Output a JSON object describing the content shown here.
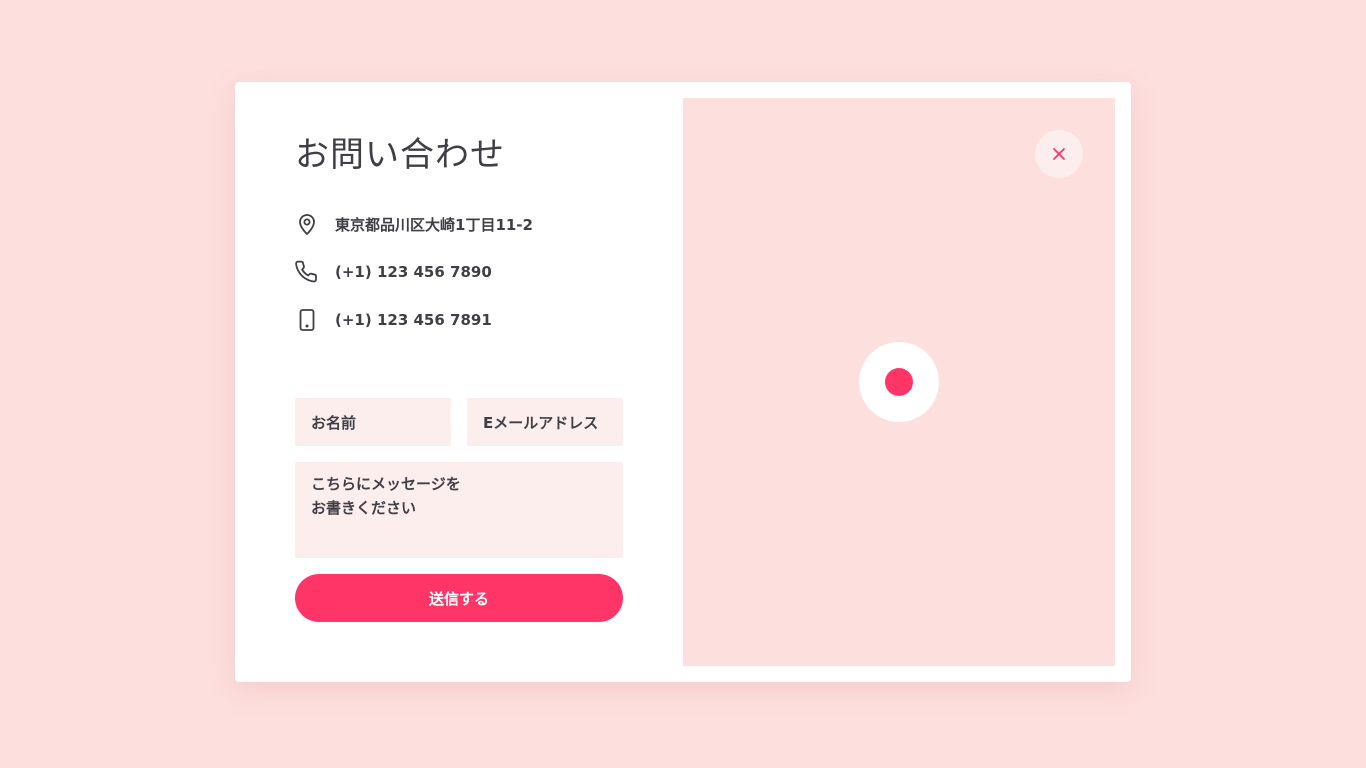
{
  "modal": {
    "title": "お問い合わせ",
    "contact": {
      "address": "東京都品川区大崎1丁目11-2",
      "phone": "(+1) 123 456 7890",
      "mobile": "(+1) 123 456 7891",
      "icons": [
        "location-pin-icon",
        "phone-icon",
        "mobile-icon"
      ]
    },
    "form": {
      "name_placeholder": "お名前",
      "email_placeholder": "Eメールアドレス",
      "message_line1": "こちらにメッセージを",
      "message_line2": "お書きください",
      "submit_label": "送信する"
    },
    "map": {
      "close_icon": "close-icon",
      "marker_icon": "map-marker-icon"
    }
  },
  "colors": {
    "background": "#fddfdd",
    "accent": "#ff3567",
    "input_bg": "#fdeeee",
    "text": "#3f3f46"
  }
}
